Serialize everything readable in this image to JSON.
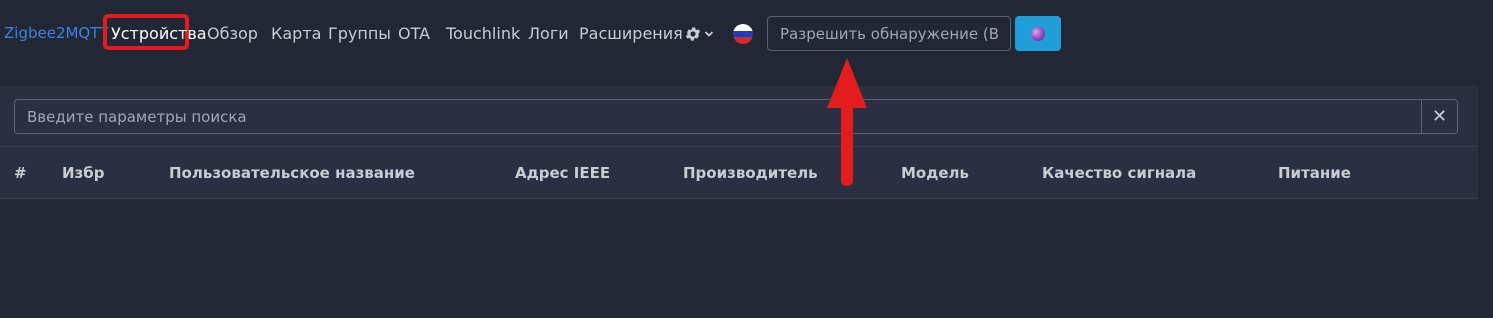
{
  "navbar": {
    "brand": "Zigbee2MQTT",
    "items": [
      {
        "label": "Устройства",
        "active": true
      },
      {
        "label": "Обзор",
        "active": false
      },
      {
        "label": "Карта",
        "active": false
      },
      {
        "label": "Группы",
        "active": false
      },
      {
        "label": "OTA",
        "active": false
      },
      {
        "label": "Touchlink",
        "active": false
      },
      {
        "label": "Логи",
        "active": false
      },
      {
        "label": "Расширения",
        "active": false
      }
    ],
    "settings_icon": "gear-dropdown-icon",
    "language_flag": "russia-flag-icon",
    "permit_join_placeholder": "Разрешить обнаружение (Все)",
    "permit_join_button_icon": "purple-dot-icon"
  },
  "search": {
    "placeholder": "Введите параметры поиска",
    "clear_icon": "close-icon",
    "clear_label": "✕"
  },
  "table": {
    "columns": [
      "#",
      "Избр",
      "Пользовательское название",
      "Адрес IEEE",
      "Производитель",
      "Модель",
      "Качество сигнала",
      "Питание"
    ],
    "rows": []
  },
  "annotation": {
    "highlight_color": "#e31d1d",
    "arrow_color": "#e31d1d"
  },
  "colors": {
    "background": "#222736",
    "card": "#2a3042",
    "brand": "#3c82e2",
    "primary_button": "#1f9ed8"
  }
}
